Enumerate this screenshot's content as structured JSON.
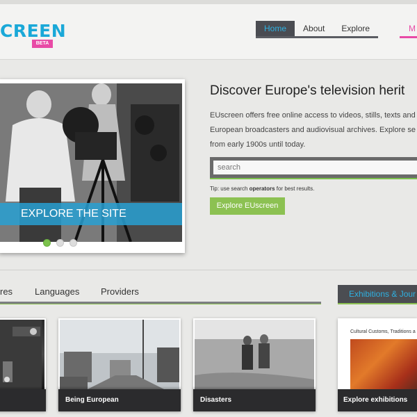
{
  "header": {
    "logo_text": "CREEN",
    "beta_badge": "BETA",
    "nav": [
      {
        "label": "Home",
        "active": true
      },
      {
        "label": "About",
        "active": false
      },
      {
        "label": "Explore",
        "active": false
      }
    ],
    "nav_partial": "M"
  },
  "slider": {
    "banner_text": "EXPLORE THE SITE",
    "active_slide": 1,
    "slide_count": 3
  },
  "intro": {
    "title": "Discover Europe's television herit",
    "lines": [
      "EUscreen offers free online access to videos, stills, texts and",
      "European broadcasters and audiovisual archives. Explore se",
      "from early 1900s until today."
    ],
    "search_placeholder": "search",
    "tip_prefix": "Tip: use search ",
    "tip_bold": "operators",
    "tip_suffix": " for best results.",
    "explore_button": "Explore EUscreen"
  },
  "tabs": [
    {
      "label": "res"
    },
    {
      "label": "Languages"
    },
    {
      "label": "Providers"
    }
  ],
  "exhibitions": {
    "header": "Exhibitions & Jour",
    "caption": "Cultural Customs, Traditions a",
    "label": "Explore exhibitions"
  },
  "cards": [
    {
      "label": ""
    },
    {
      "label": "Being European"
    },
    {
      "label": "Disasters"
    }
  ],
  "colors": {
    "brand_blue": "#1aa8d8",
    "beta_pink": "#e84aa6",
    "accent_green": "#8cc152",
    "nav_dark": "#4a4c52"
  }
}
